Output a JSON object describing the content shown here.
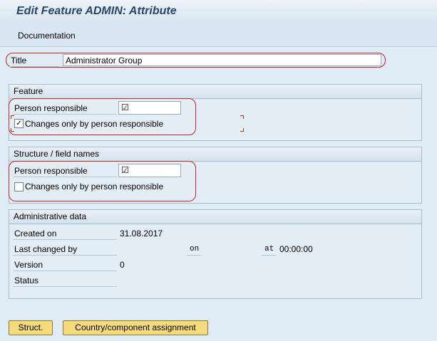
{
  "window": {
    "title": "Edit Feature ADMIN: Attribute"
  },
  "menu": {
    "documentation": "Documentation"
  },
  "title_field": {
    "label": "Title",
    "value": "Administrator Group"
  },
  "feature": {
    "header": "Feature",
    "person_label": "Person responsible",
    "person_value": "☑",
    "changes_label": "Changes only by person responsible",
    "changes_checked": true
  },
  "structure": {
    "header": "Structure / field names",
    "person_label": "Person responsible",
    "person_value": "☑",
    "changes_label": "Changes only by person responsible",
    "changes_checked": false
  },
  "admin": {
    "header": "Administrative data",
    "created_label": "Created on",
    "created_value": "31.08.2017",
    "changed_label": "Last changed by",
    "on_label": "on",
    "at_label": "at",
    "at_value": "00:00:00",
    "version_label": "Version",
    "version_value": "0",
    "status_label": "Status"
  },
  "buttons": {
    "struct": "Struct.",
    "country": "Country/component assignment"
  }
}
